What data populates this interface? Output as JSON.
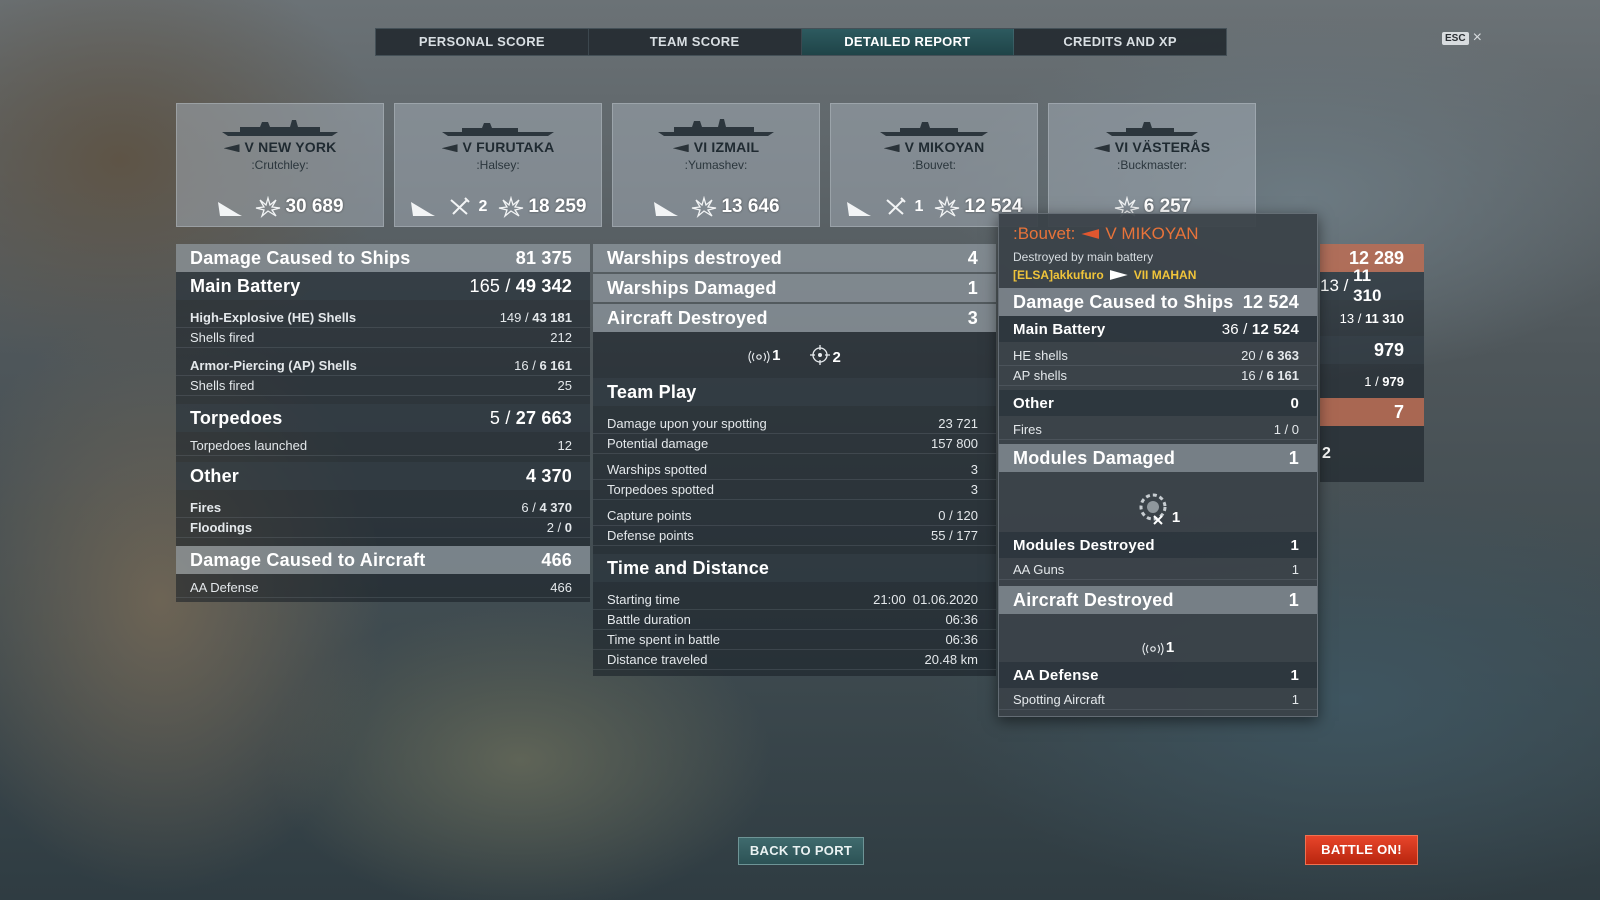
{
  "tabs": [
    {
      "label": "PERSONAL SCORE",
      "active": false
    },
    {
      "label": "TEAM SCORE",
      "active": false
    },
    {
      "label": "DETAILED REPORT",
      "active": true
    },
    {
      "label": "CREDITS AND XP",
      "active": false
    }
  ],
  "esc": {
    "key": "ESC",
    "close": "×"
  },
  "ships": [
    {
      "tier_name": "V NEW YORK",
      "player": ":Crutchley:",
      "planes": null,
      "damage": "30 689"
    },
    {
      "tier_name": "V FURUTAKA",
      "player": ":Halsey:",
      "planes": "2",
      "damage": "18 259"
    },
    {
      "tier_name": "VI IZMAIL",
      "player": ":Yumashev:",
      "planes": null,
      "damage": "13 646"
    },
    {
      "tier_name": "V MIKOYAN",
      "player": ":Bouvet:",
      "planes": "1",
      "damage": "12 524"
    },
    {
      "tier_name": "VI VÄSTERÅS",
      "player": ":Buckmaster:",
      "planes": null,
      "damage": "6 257"
    }
  ],
  "left": {
    "damage_ships": {
      "label": "Damage Caused to Ships",
      "value": "81 375"
    },
    "main_battery": {
      "label": "Main Battery",
      "hits": "165",
      "dmg": "49 342"
    },
    "he": {
      "label": "High-Explosive (HE) Shells",
      "hits": "149",
      "dmg": "43 181",
      "fired_label": "Shells fired",
      "fired": "212"
    },
    "ap": {
      "label": "Armor-Piercing (AP) Shells",
      "hits": "16",
      "dmg": "6 161",
      "fired_label": "Shells fired",
      "fired": "25"
    },
    "torpedoes": {
      "label": "Torpedoes",
      "hits": "5",
      "dmg": "27 663",
      "launched_label": "Torpedoes launched",
      "launched": "12"
    },
    "other": {
      "label": "Other",
      "value": "4 370"
    },
    "fires": {
      "label": "Fires",
      "hits": "6",
      "dmg": "4 370"
    },
    "floodings": {
      "label": "Floodings",
      "hits": "2",
      "dmg": "0"
    },
    "damage_aircraft": {
      "label": "Damage Caused to Aircraft",
      "value": "466"
    },
    "aa": {
      "label": "AA Defense",
      "value": "466"
    }
  },
  "mid": {
    "warships_destroyed": {
      "label": "Warships destroyed",
      "value": "4"
    },
    "warships_damaged": {
      "label": "Warships Damaged",
      "value": "1"
    },
    "aircraft_destroyed": {
      "label": "Aircraft Destroyed",
      "value": "3"
    },
    "aircraft_icons": [
      {
        "icon": "spotter-plane-icon",
        "count": "1"
      },
      {
        "icon": "fighter-crosshair-icon",
        "count": "2"
      }
    ],
    "team_play": {
      "label": "Team Play",
      "rows": [
        {
          "label": "Damage upon your spotting",
          "value": "23 721"
        },
        {
          "label": "Potential damage",
          "value": "157 800"
        },
        {
          "label": "Warships spotted",
          "value": "3"
        },
        {
          "label": "Torpedoes spotted",
          "value": "3"
        },
        {
          "label": "Capture points",
          "value": "0 / 120"
        },
        {
          "label": "Defense points",
          "value": "55 / 177"
        }
      ]
    },
    "time": {
      "label": "Time and Distance",
      "rows": [
        {
          "label": "Starting time",
          "value": "21:00  01.06.2020"
        },
        {
          "label": "Battle duration",
          "value": "06:36"
        },
        {
          "label": "Time spent in battle",
          "value": "06:36"
        },
        {
          "label": "Distance traveled",
          "value": "20.48 km"
        }
      ]
    }
  },
  "tooltip": {
    "player": ":Bouvet:",
    "ship": "V MIKOYAN",
    "cause": "Destroyed by main battery",
    "killer": "[ELSA]akkufuro",
    "killer_ship": "VII MAHAN",
    "damage": {
      "label": "Damage Caused to Ships",
      "value": "12 524"
    },
    "main_battery": {
      "label": "Main Battery",
      "hits": "36",
      "dmg": "12 524"
    },
    "he": {
      "label": "HE shells",
      "hits": "20",
      "dmg": "6 363"
    },
    "ap": {
      "label": "AP shells",
      "hits": "16",
      "dmg": "6 161"
    },
    "other": {
      "label": "Other",
      "value": "0"
    },
    "fires": {
      "label": "Fires",
      "value": "1 / 0"
    },
    "modules_damaged": {
      "label": "Modules Damaged",
      "value": "1"
    },
    "module_icon_count": "1",
    "modules_destroyed": {
      "label": "Modules Destroyed",
      "value": "1"
    },
    "aa_guns": {
      "label": "AA Guns",
      "value": "1"
    },
    "aircraft_destroyed": {
      "label": "Aircraft Destroyed",
      "value": "1"
    },
    "aircraft_icon_count": "1",
    "aa_defense": {
      "label": "AA Defense",
      "value": "1"
    },
    "spotting": {
      "label": "Spotting Aircraft",
      "value": "1"
    }
  },
  "right_partial": {
    "r1": "12 289",
    "r2a": "13",
    "r2b": "11 310",
    "r3a": "13",
    "r3b": "11 310",
    "r4": "979",
    "r5a": "1",
    "r5b": "979",
    "r6": "7",
    "r7": "2"
  },
  "buttons": {
    "back": "BACK TO PORT",
    "battle": "BATTLE ON!"
  },
  "colors": {
    "accent_teal": "#2d5a5f",
    "battle_red": "#d9381e",
    "tooltip_orange": "#e8733a",
    "killer_yellow": "#f0c43a"
  }
}
